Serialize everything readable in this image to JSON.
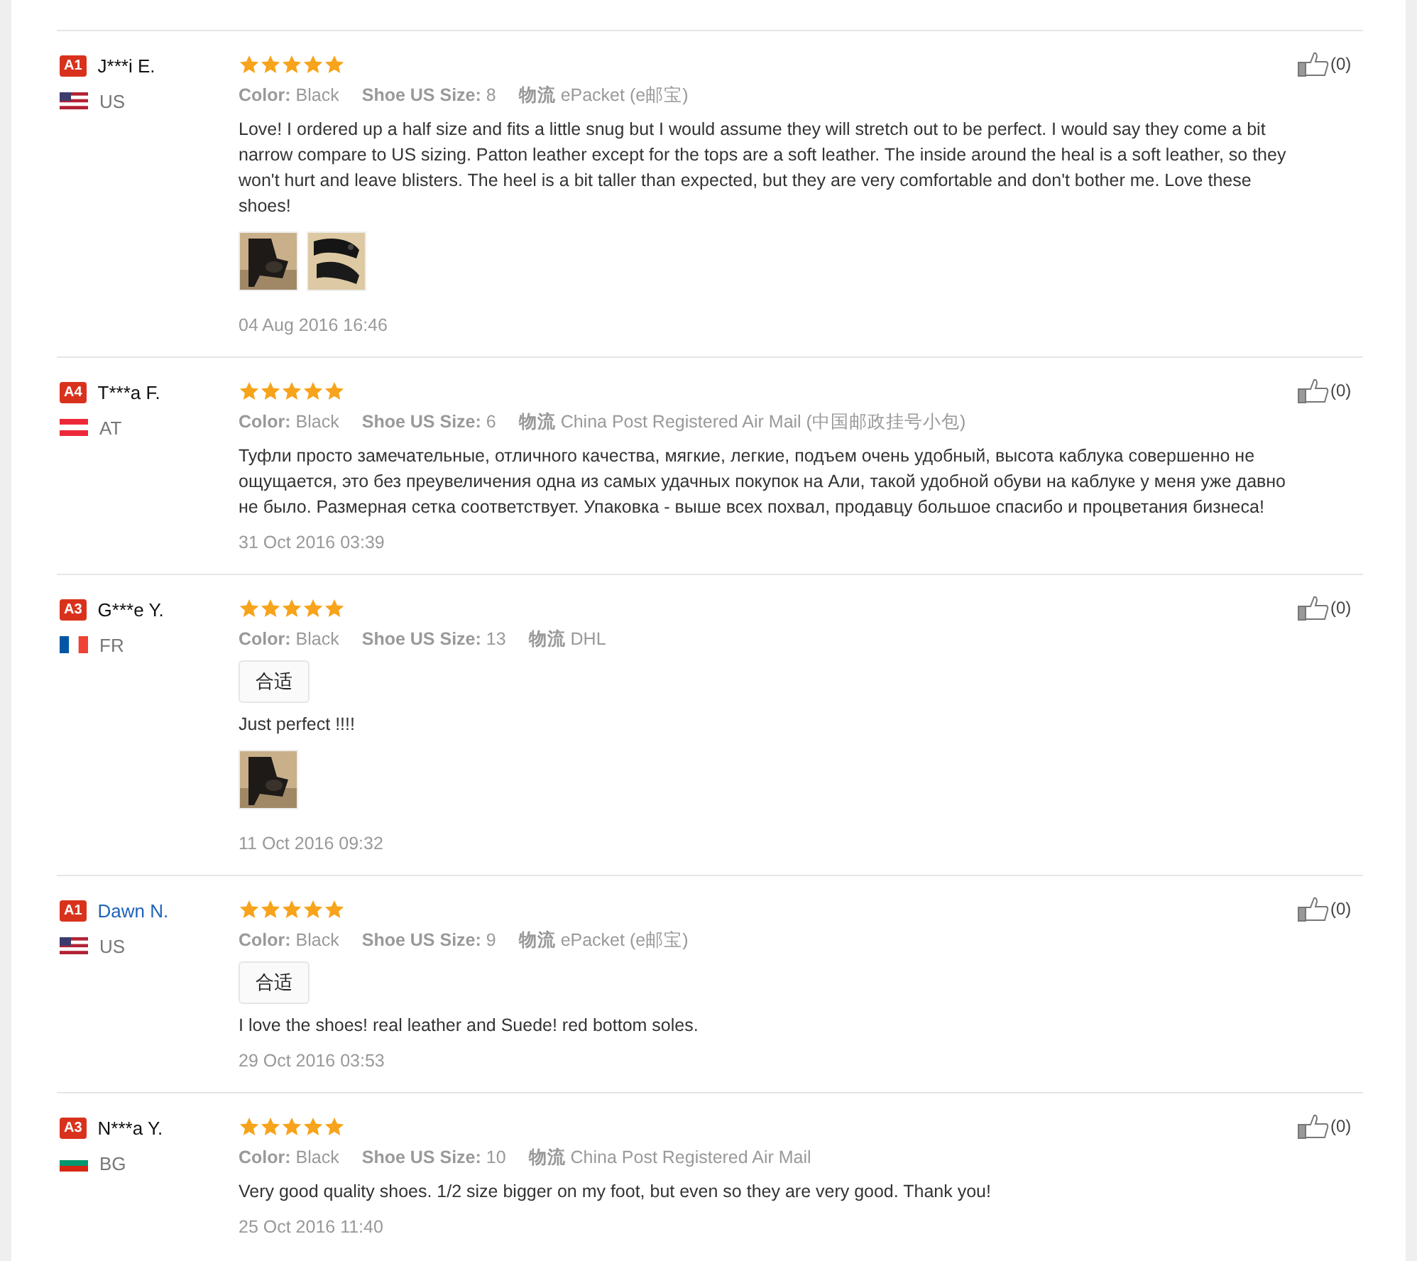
{
  "reviews": [
    {
      "level_badge": "A1",
      "name": "J***i E.",
      "link": false,
      "flag": {
        "kind": "us"
      },
      "country": "US",
      "stars": 5,
      "meta": [
        {
          "label": "Color:",
          "value": "Black"
        },
        {
          "label": "Shoe US Size:",
          "value": "8"
        },
        {
          "label": "物流",
          "value": "ePacket (e邮宝)"
        }
      ],
      "text": "Love! I ordered up a half size and fits a little snug but I would assume they will stretch out to be perfect. I would say they come a bit narrow compare to US sizing. Patton leather except for the tops are a soft leather. The inside around the heal is a soft leather, so they won't hurt and leave blisters. The heel is a bit taller than expected, but they are very comfortable and don't bother me. Love these shoes!",
      "photos": [
        {
          "kind": "picture"
        },
        {
          "kind": "picture"
        }
      ],
      "date": "04 Aug 2016 16:46",
      "likes": "(0)"
    },
    {
      "level_badge": "A4",
      "name": "T***a F.",
      "link": false,
      "flag": {
        "kind": "at"
      },
      "country": "AT",
      "stars": 5,
      "meta": [
        {
          "label": "Color:",
          "value": "Black"
        },
        {
          "label": "Shoe US Size:",
          "value": "6"
        },
        {
          "label": "物流",
          "value": "China Post Registered Air Mail (中国邮政挂号小包)"
        }
      ],
      "text": "Туфли просто замечательные, отличного качества, мягкие, легкие, подъем очень удобный, высота каблука совершенно не ощущается, это без преувеличения одна из самых удачных покупок на Али, такой удобной обуви на каблуке у меня уже давно не было. Размерная сетка соответствует. Упаковка - выше всех похвал, продавцу большое спасибо и процветания бизнеса!",
      "date": "31 Oct 2016 03:39",
      "likes": "(0)"
    },
    {
      "level_badge": "A3",
      "name": "G***e Y.",
      "link": false,
      "flag": {
        "kind": "fr"
      },
      "country": "FR",
      "stars": 5,
      "meta": [
        {
          "label": "Color:",
          "value": "Black"
        },
        {
          "label": "Shoe US Size:",
          "value": "13"
        },
        {
          "label": "物流",
          "value": "DHL"
        }
      ],
      "tag": "合适",
      "text": "Just perfect !!!!",
      "photos": [
        {
          "kind": "picture"
        }
      ],
      "date": "11 Oct 2016 09:32",
      "likes": "(0)"
    },
    {
      "level_badge": "A1",
      "name": "Dawn N.",
      "link": true,
      "flag": {
        "kind": "us"
      },
      "country": "US",
      "stars": 5,
      "meta": [
        {
          "label": "Color:",
          "value": "Black"
        },
        {
          "label": "Shoe US Size:",
          "value": "9"
        },
        {
          "label": "物流",
          "value": "ePacket (e邮宝)"
        }
      ],
      "tag": "合适",
      "text": "I love the shoes! real leather and Suede! red bottom soles.",
      "date": "29 Oct 2016 03:53",
      "likes": "(0)"
    },
    {
      "level_badge": "A3",
      "name": "N***a Y.",
      "link": false,
      "flag": {
        "kind": "bg"
      },
      "country": "BG",
      "stars": 5,
      "meta": [
        {
          "label": "Color:",
          "value": "Black"
        },
        {
          "label": "Shoe US Size:",
          "value": "10"
        },
        {
          "label": "物流",
          "value": "China Post Registered Air Mail"
        }
      ],
      "text": "Very good quality shoes. 1/2 size bigger on my foot, but even so they are very good. Thank you!",
      "date": "25 Oct 2016 11:40",
      "likes": "(0)"
    }
  ]
}
